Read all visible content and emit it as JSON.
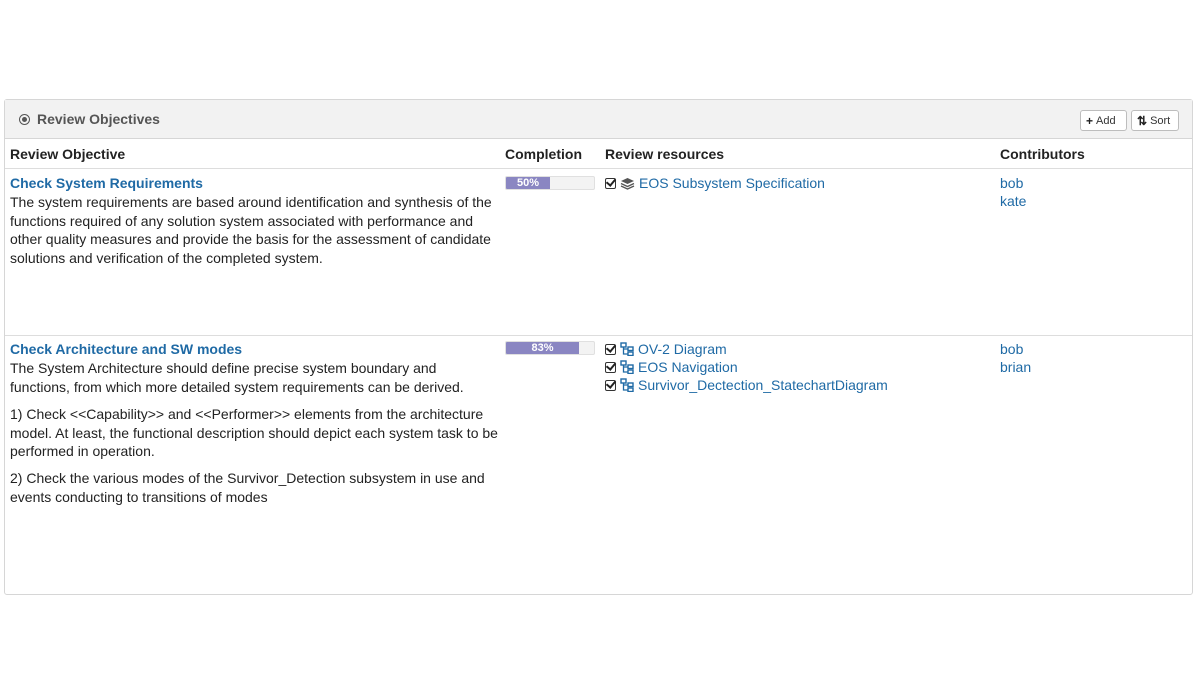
{
  "panel": {
    "title": "Review Objectives",
    "add_label": "Add",
    "sort_label": "Sort"
  },
  "columns": {
    "objective": "Review Objective",
    "completion": "Completion",
    "resources": "Review resources",
    "contributors": "Contributors"
  },
  "rows": [
    {
      "title": "Check System Requirements",
      "description": [
        "The system requirements are based around identification and synthesis of the functions required of any solution system associated with performance and other quality measures and provide the basis for the assessment of candidate solutions and verification of the completed system."
      ],
      "completion_percent": 50,
      "completion_label": "50%",
      "resources": [
        {
          "icon": "layers-icon",
          "label": "EOS Subsystem Specification"
        }
      ],
      "contributors": [
        "bob",
        "kate"
      ]
    },
    {
      "title": "Check Architecture and SW modes",
      "description": [
        "The System Architecture should define precise system boundary and functions, from which more detailed system requirements can be derived.",
        "1) Check <<Capability>>  and <<Performer>> elements from the architecture model. At least, the functional description should depict each system task to be performed in operation.",
        "2) Check the various modes of the Survivor_Detection subsystem in use and events conducting to transitions of modes"
      ],
      "completion_percent": 83,
      "completion_label": "83%",
      "resources": [
        {
          "icon": "diagram-icon",
          "label": "OV-2 Diagram"
        },
        {
          "icon": "diagram-icon",
          "label": "EOS Navigation"
        },
        {
          "icon": "diagram-icon",
          "label": "Survivor_Dectection_StatechartDiagram"
        }
      ],
      "contributors": [
        "bob",
        "brian"
      ]
    }
  ]
}
